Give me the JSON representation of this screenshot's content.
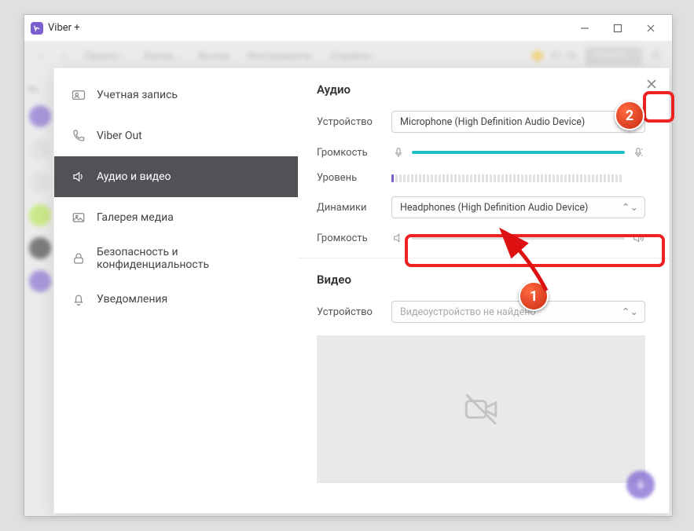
{
  "window": {
    "title": "Viber +"
  },
  "toolbar_bg": {
    "items": [
      "Проигр...",
      "Бесед...",
      "Вызов",
      "Инструменты",
      "Справка"
    ],
    "coins": "€1.16",
    "button": "Попол..."
  },
  "iz_label": "Из",
  "sidenav": {
    "items": [
      {
        "label": "Учетная запись"
      },
      {
        "label": "Viber Out"
      },
      {
        "label": "Аудио и видео"
      },
      {
        "label": "Галерея медиа"
      },
      {
        "label": "Безопасность и конфиденциальность"
      },
      {
        "label": "Уведомления"
      }
    ],
    "active_index": 2
  },
  "audio": {
    "title": "Аудио",
    "device_label": "Устройство",
    "device_value": "Microphone (High Definition Audio Device)",
    "volume_label": "Громкость",
    "level_label": "Уровень",
    "speakers_label": "Динамики",
    "speakers_value": "Headphones (High Definition Audio Device)",
    "speakers_volume_label": "Громкость"
  },
  "video": {
    "title": "Видео",
    "device_label": "Устройство",
    "device_value": "Видеоустройство не найдено"
  },
  "annotations": {
    "badge1": "1",
    "badge2": "2"
  }
}
